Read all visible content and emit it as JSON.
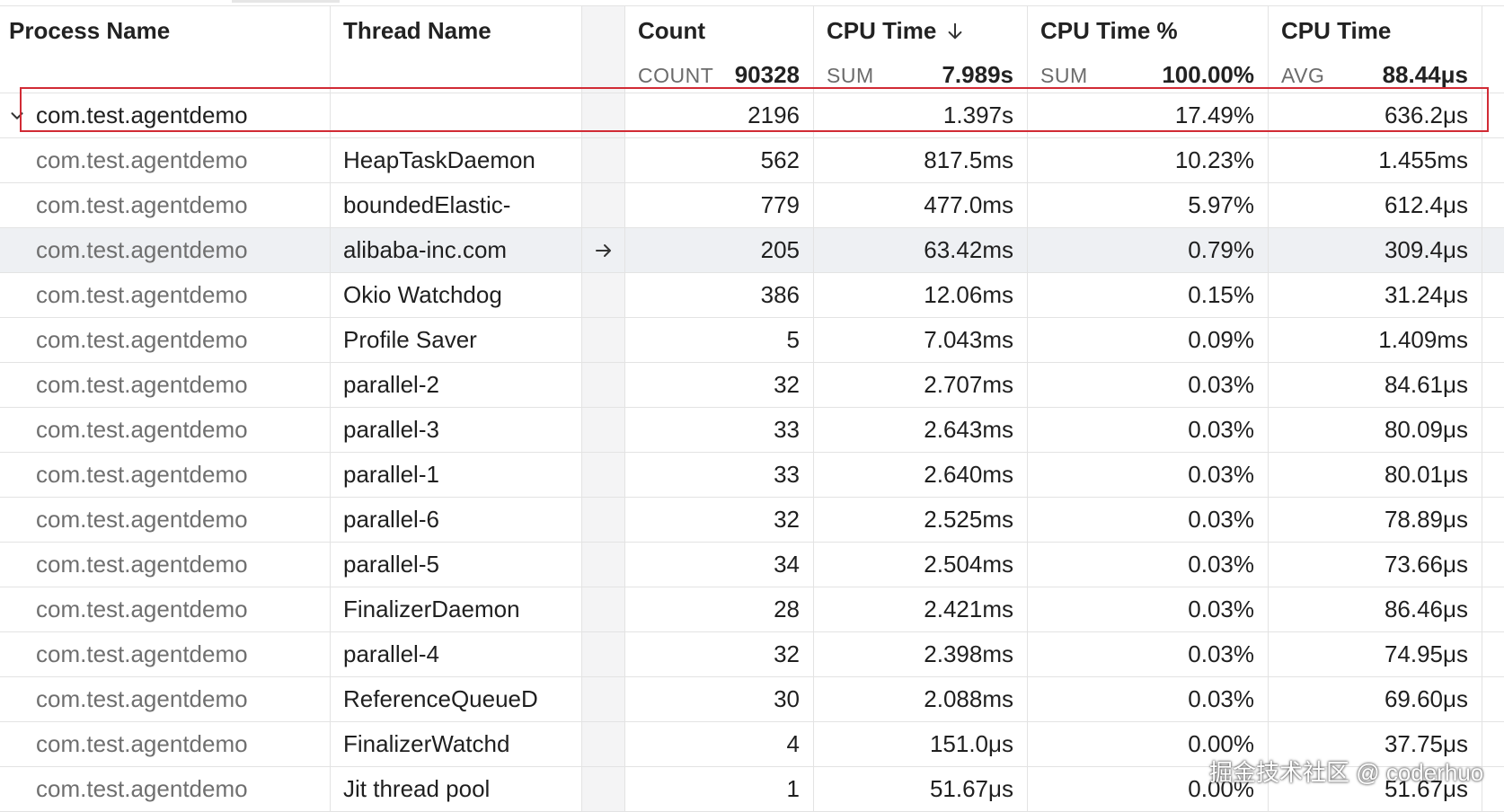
{
  "header": {
    "process_name": "Process Name",
    "thread_name": "Thread Name",
    "count": {
      "title": "Count",
      "agg": "COUNT",
      "total": "90328"
    },
    "cpu_time": {
      "title": "CPU Time",
      "agg": "SUM",
      "total": "7.989s",
      "sort": "arrow-down-icon"
    },
    "cpu_pct": {
      "title": "CPU Time %",
      "agg": "SUM",
      "total": "100.00%"
    },
    "cpu_avg": {
      "title": "CPU Time",
      "agg": "AVG",
      "total": "88.44μs"
    }
  },
  "group_row": {
    "process": "com.test.agentdemo",
    "thread": "",
    "count": "2196",
    "cpu_time": "1.397s",
    "cpu_pct": "17.49%",
    "cpu_avg": "636.2μs",
    "expanded": true
  },
  "rows": [
    {
      "process": "com.test.agentdemo",
      "thread": "HeapTaskDaemon",
      "count": "562",
      "cpu_time": "817.5ms",
      "cpu_pct": "10.23%",
      "cpu_avg": "1.455ms"
    },
    {
      "process": "com.test.agentdemo",
      "thread": "boundedElastic-",
      "count": "779",
      "cpu_time": "477.0ms",
      "cpu_pct": "5.97%",
      "cpu_avg": "612.4μs"
    },
    {
      "process": "com.test.agentdemo",
      "thread": "alibaba-inc.com",
      "count": "205",
      "cpu_time": "63.42ms",
      "cpu_pct": "0.79%",
      "cpu_avg": "309.4μs",
      "hover": true
    },
    {
      "process": "com.test.agentdemo",
      "thread": "Okio Watchdog",
      "count": "386",
      "cpu_time": "12.06ms",
      "cpu_pct": "0.15%",
      "cpu_avg": "31.24μs"
    },
    {
      "process": "com.test.agentdemo",
      "thread": "Profile Saver",
      "count": "5",
      "cpu_time": "7.043ms",
      "cpu_pct": "0.09%",
      "cpu_avg": "1.409ms"
    },
    {
      "process": "com.test.agentdemo",
      "thread": "parallel-2",
      "count": "32",
      "cpu_time": "2.707ms",
      "cpu_pct": "0.03%",
      "cpu_avg": "84.61μs"
    },
    {
      "process": "com.test.agentdemo",
      "thread": "parallel-3",
      "count": "33",
      "cpu_time": "2.643ms",
      "cpu_pct": "0.03%",
      "cpu_avg": "80.09μs"
    },
    {
      "process": "com.test.agentdemo",
      "thread": "parallel-1",
      "count": "33",
      "cpu_time": "2.640ms",
      "cpu_pct": "0.03%",
      "cpu_avg": "80.01μs"
    },
    {
      "process": "com.test.agentdemo",
      "thread": "parallel-6",
      "count": "32",
      "cpu_time": "2.525ms",
      "cpu_pct": "0.03%",
      "cpu_avg": "78.89μs"
    },
    {
      "process": "com.test.agentdemo",
      "thread": "parallel-5",
      "count": "34",
      "cpu_time": "2.504ms",
      "cpu_pct": "0.03%",
      "cpu_avg": "73.66μs"
    },
    {
      "process": "com.test.agentdemo",
      "thread": "FinalizerDaemon",
      "count": "28",
      "cpu_time": "2.421ms",
      "cpu_pct": "0.03%",
      "cpu_avg": "86.46μs"
    },
    {
      "process": "com.test.agentdemo",
      "thread": "parallel-4",
      "count": "32",
      "cpu_time": "2.398ms",
      "cpu_pct": "0.03%",
      "cpu_avg": "74.95μs"
    },
    {
      "process": "com.test.agentdemo",
      "thread": "ReferenceQueueD",
      "count": "30",
      "cpu_time": "2.088ms",
      "cpu_pct": "0.03%",
      "cpu_avg": "69.60μs"
    },
    {
      "process": "com.test.agentdemo",
      "thread": "FinalizerWatchd",
      "count": "4",
      "cpu_time": "151.0μs",
      "cpu_pct": "0.00%",
      "cpu_avg": "37.75μs"
    },
    {
      "process": "com.test.agentdemo",
      "thread": "Jit thread pool",
      "count": "1",
      "cpu_time": "51.67μs",
      "cpu_pct": "0.00%",
      "cpu_avg": "51.67μs"
    }
  ],
  "watermark": "掘金技术社区 @ coderhuo",
  "colors": {
    "selection_border": "#d12b35",
    "hover_row": "#eef0f3",
    "grid_line": "#e3e3e3"
  }
}
